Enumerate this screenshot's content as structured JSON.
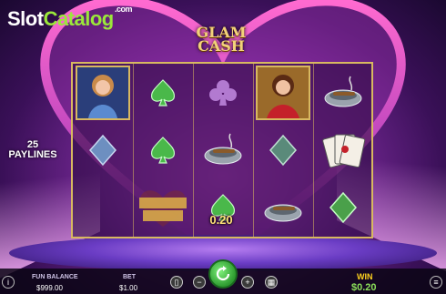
{
  "watermark": {
    "slot": "Slot",
    "catalog": "Catalog",
    "com": ".com"
  },
  "logo": {
    "line1": "GLAM",
    "line2": "CASH"
  },
  "paylines": {
    "count": "25",
    "label": "PAYLINES"
  },
  "overlay_win": "0.20",
  "bottom_bar": {
    "balance_label": "FUN BALANCE",
    "balance_value": "$999.00",
    "bet_label": "BET",
    "bet_value": "$1.00",
    "win_label": "WIN",
    "win_value": "$0.20"
  },
  "reels": [
    [
      "lady-blue",
      "blue-diamond",
      "blank"
    ],
    [
      "green-spade",
      "green-spade",
      "glam-cash-logo"
    ],
    [
      "purple-club",
      "ashtray-cigar",
      "green-spade"
    ],
    [
      "lady-red",
      "green-diamond",
      "ashtray-cigar"
    ],
    [
      "ashtray-cigar",
      "playing-cards",
      "green-diamond"
    ]
  ],
  "colors": {
    "frame": "#d8b860",
    "win_green": "#8be05a",
    "win_yellow": "#ffd21e",
    "spin_green": "#2d9a2f"
  }
}
